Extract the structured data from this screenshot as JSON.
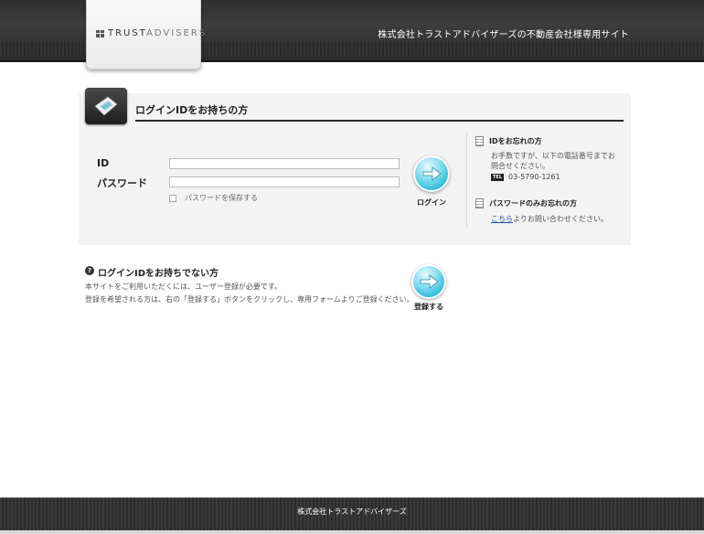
{
  "header": {
    "logo_prefix": "TRUST",
    "logo_suffix": "ADVISERS",
    "site_title": "株式会社トラストアドバイザーズの不動産会社様専用サイト"
  },
  "login": {
    "title": "ログインIDをお持ちの方",
    "id_label": "ID",
    "password_label": "パスワード",
    "id_value": "",
    "password_value": "",
    "save_password_label": "パスワードを保存する",
    "login_button_label": "ログイン"
  },
  "aside": {
    "forgot_id_title": "IDをお忘れの方",
    "forgot_id_text": "お手数ですが、以下の電話番号までお問合せください。",
    "tel_badge": "TEL",
    "tel_number": "03-5790-1261",
    "forgot_pw_title": "パスワードのみお忘れの方",
    "forgot_pw_link": "こちら",
    "forgot_pw_text": "よりお問い合わせください。"
  },
  "register": {
    "title": "ログインIDをお持ちでない方",
    "line1": "本サイトをご利用いただくには、ユーザー登録が必要です。",
    "line2": "登録を希望される方は、右の「登録する」ボタンをクリックし、専用フォームよりご登録ください。",
    "button_label": "登録する"
  },
  "footer": {
    "company": "株式会社トラストアドバイザーズ"
  },
  "icons": {
    "panel_icon": "ticket-icon",
    "arrow": "arrow-right-icon",
    "question": "question-icon",
    "document": "document-icon"
  }
}
